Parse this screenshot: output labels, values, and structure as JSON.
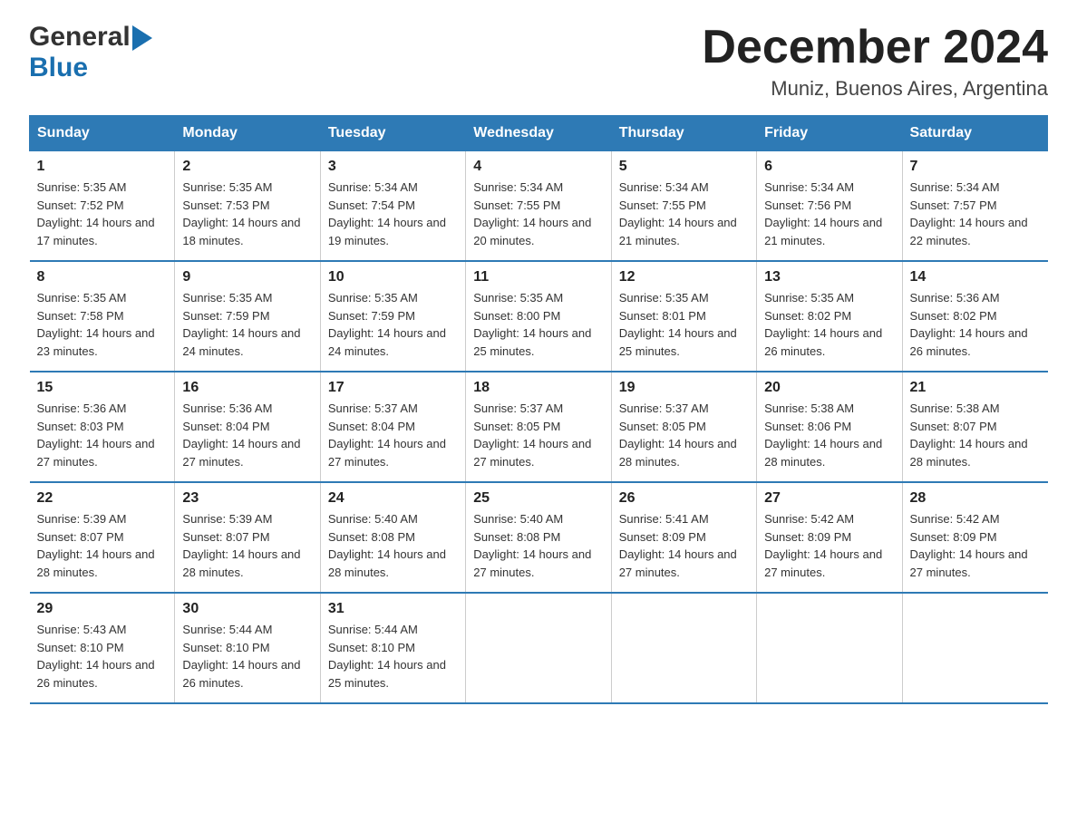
{
  "logo": {
    "general": "General",
    "blue": "Blue"
  },
  "header": {
    "month": "December 2024",
    "location": "Muniz, Buenos Aires, Argentina"
  },
  "weekdays": [
    "Sunday",
    "Monday",
    "Tuesday",
    "Wednesday",
    "Thursday",
    "Friday",
    "Saturday"
  ],
  "weeks": [
    [
      {
        "day": "1",
        "sunrise": "Sunrise: 5:35 AM",
        "sunset": "Sunset: 7:52 PM",
        "daylight": "Daylight: 14 hours and 17 minutes."
      },
      {
        "day": "2",
        "sunrise": "Sunrise: 5:35 AM",
        "sunset": "Sunset: 7:53 PM",
        "daylight": "Daylight: 14 hours and 18 minutes."
      },
      {
        "day": "3",
        "sunrise": "Sunrise: 5:34 AM",
        "sunset": "Sunset: 7:54 PM",
        "daylight": "Daylight: 14 hours and 19 minutes."
      },
      {
        "day": "4",
        "sunrise": "Sunrise: 5:34 AM",
        "sunset": "Sunset: 7:55 PM",
        "daylight": "Daylight: 14 hours and 20 minutes."
      },
      {
        "day": "5",
        "sunrise": "Sunrise: 5:34 AM",
        "sunset": "Sunset: 7:55 PM",
        "daylight": "Daylight: 14 hours and 21 minutes."
      },
      {
        "day": "6",
        "sunrise": "Sunrise: 5:34 AM",
        "sunset": "Sunset: 7:56 PM",
        "daylight": "Daylight: 14 hours and 21 minutes."
      },
      {
        "day": "7",
        "sunrise": "Sunrise: 5:34 AM",
        "sunset": "Sunset: 7:57 PM",
        "daylight": "Daylight: 14 hours and 22 minutes."
      }
    ],
    [
      {
        "day": "8",
        "sunrise": "Sunrise: 5:35 AM",
        "sunset": "Sunset: 7:58 PM",
        "daylight": "Daylight: 14 hours and 23 minutes."
      },
      {
        "day": "9",
        "sunrise": "Sunrise: 5:35 AM",
        "sunset": "Sunset: 7:59 PM",
        "daylight": "Daylight: 14 hours and 24 minutes."
      },
      {
        "day": "10",
        "sunrise": "Sunrise: 5:35 AM",
        "sunset": "Sunset: 7:59 PM",
        "daylight": "Daylight: 14 hours and 24 minutes."
      },
      {
        "day": "11",
        "sunrise": "Sunrise: 5:35 AM",
        "sunset": "Sunset: 8:00 PM",
        "daylight": "Daylight: 14 hours and 25 minutes."
      },
      {
        "day": "12",
        "sunrise": "Sunrise: 5:35 AM",
        "sunset": "Sunset: 8:01 PM",
        "daylight": "Daylight: 14 hours and 25 minutes."
      },
      {
        "day": "13",
        "sunrise": "Sunrise: 5:35 AM",
        "sunset": "Sunset: 8:02 PM",
        "daylight": "Daylight: 14 hours and 26 minutes."
      },
      {
        "day": "14",
        "sunrise": "Sunrise: 5:36 AM",
        "sunset": "Sunset: 8:02 PM",
        "daylight": "Daylight: 14 hours and 26 minutes."
      }
    ],
    [
      {
        "day": "15",
        "sunrise": "Sunrise: 5:36 AM",
        "sunset": "Sunset: 8:03 PM",
        "daylight": "Daylight: 14 hours and 27 minutes."
      },
      {
        "day": "16",
        "sunrise": "Sunrise: 5:36 AM",
        "sunset": "Sunset: 8:04 PM",
        "daylight": "Daylight: 14 hours and 27 minutes."
      },
      {
        "day": "17",
        "sunrise": "Sunrise: 5:37 AM",
        "sunset": "Sunset: 8:04 PM",
        "daylight": "Daylight: 14 hours and 27 minutes."
      },
      {
        "day": "18",
        "sunrise": "Sunrise: 5:37 AM",
        "sunset": "Sunset: 8:05 PM",
        "daylight": "Daylight: 14 hours and 27 minutes."
      },
      {
        "day": "19",
        "sunrise": "Sunrise: 5:37 AM",
        "sunset": "Sunset: 8:05 PM",
        "daylight": "Daylight: 14 hours and 28 minutes."
      },
      {
        "day": "20",
        "sunrise": "Sunrise: 5:38 AM",
        "sunset": "Sunset: 8:06 PM",
        "daylight": "Daylight: 14 hours and 28 minutes."
      },
      {
        "day": "21",
        "sunrise": "Sunrise: 5:38 AM",
        "sunset": "Sunset: 8:07 PM",
        "daylight": "Daylight: 14 hours and 28 minutes."
      }
    ],
    [
      {
        "day": "22",
        "sunrise": "Sunrise: 5:39 AM",
        "sunset": "Sunset: 8:07 PM",
        "daylight": "Daylight: 14 hours and 28 minutes."
      },
      {
        "day": "23",
        "sunrise": "Sunrise: 5:39 AM",
        "sunset": "Sunset: 8:07 PM",
        "daylight": "Daylight: 14 hours and 28 minutes."
      },
      {
        "day": "24",
        "sunrise": "Sunrise: 5:40 AM",
        "sunset": "Sunset: 8:08 PM",
        "daylight": "Daylight: 14 hours and 28 minutes."
      },
      {
        "day": "25",
        "sunrise": "Sunrise: 5:40 AM",
        "sunset": "Sunset: 8:08 PM",
        "daylight": "Daylight: 14 hours and 27 minutes."
      },
      {
        "day": "26",
        "sunrise": "Sunrise: 5:41 AM",
        "sunset": "Sunset: 8:09 PM",
        "daylight": "Daylight: 14 hours and 27 minutes."
      },
      {
        "day": "27",
        "sunrise": "Sunrise: 5:42 AM",
        "sunset": "Sunset: 8:09 PM",
        "daylight": "Daylight: 14 hours and 27 minutes."
      },
      {
        "day": "28",
        "sunrise": "Sunrise: 5:42 AM",
        "sunset": "Sunset: 8:09 PM",
        "daylight": "Daylight: 14 hours and 27 minutes."
      }
    ],
    [
      {
        "day": "29",
        "sunrise": "Sunrise: 5:43 AM",
        "sunset": "Sunset: 8:10 PM",
        "daylight": "Daylight: 14 hours and 26 minutes."
      },
      {
        "day": "30",
        "sunrise": "Sunrise: 5:44 AM",
        "sunset": "Sunset: 8:10 PM",
        "daylight": "Daylight: 14 hours and 26 minutes."
      },
      {
        "day": "31",
        "sunrise": "Sunrise: 5:44 AM",
        "sunset": "Sunset: 8:10 PM",
        "daylight": "Daylight: 14 hours and 25 minutes."
      },
      null,
      null,
      null,
      null
    ]
  ]
}
